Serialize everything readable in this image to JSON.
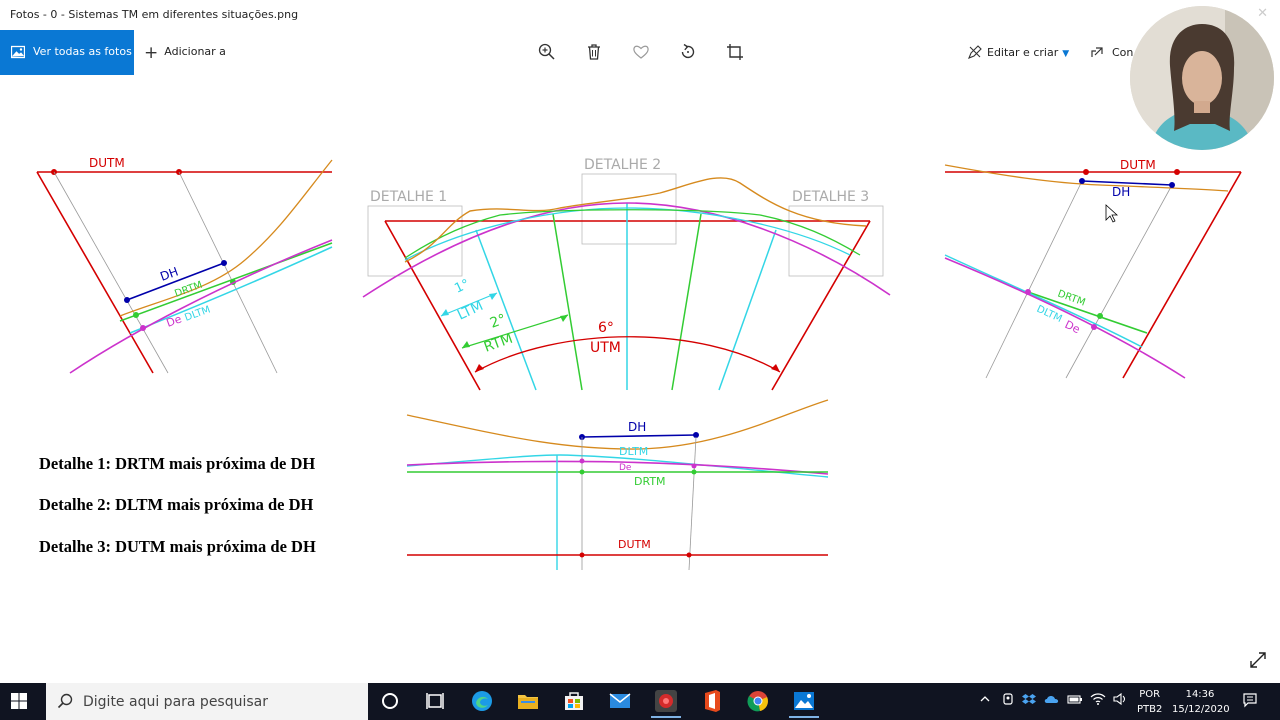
{
  "window": {
    "title": "Fotos - 0 - Sistemas TM em diferentes situações.png",
    "close_glyph": "✕"
  },
  "toolbar": {
    "view_all_label": "Ver todas as fotos",
    "add_label": "Adicionar a",
    "edit_label": "Editar e criar",
    "share_label": "Con",
    "icons": [
      "zoom-in-icon",
      "delete-icon",
      "favorite-icon",
      "rotate-icon",
      "crop-icon"
    ]
  },
  "diagram": {
    "left": {
      "durtm": "DUTM",
      "dh": "DH",
      "drtm": "DRTM",
      "de": "De",
      "dltm": "DLTM"
    },
    "center": {
      "detail1": "DETALHE 1",
      "detail2": "DETALHE 2",
      "detail3": "DETALHE 3",
      "angle_ltm": "1°",
      "ltm": "LTM",
      "angle_rtm": "2°",
      "rtm": "RTM",
      "angle_utm": "6°",
      "utm": "UTM"
    },
    "right": {
      "durtm": "DUTM",
      "dh": "DH",
      "drtm": "DRTM",
      "dltm": "DLTM",
      "de": "De"
    },
    "bottom": {
      "dh": "DH",
      "dltm": "DLTM",
      "de": "De",
      "drtm": "DRTM",
      "durtm": "DUTM"
    },
    "colors": {
      "red": "#d40000",
      "orange": "#d68a1e",
      "green": "#33cc33",
      "cyan": "#33d6e6",
      "magenta": "#cc33cc",
      "blue": "#0000aa",
      "gray": "#999999"
    }
  },
  "captions": [
    "Detalhe 1: DRTM mais próxima de DH",
    "Detalhe 2: DLTM mais próxima de DH",
    "Detalhe 3: DUTM mais próxima de DH"
  ],
  "taskbar": {
    "search_placeholder": "Digite aqui para pesquisar",
    "language_top": "POR",
    "language_bottom": "PTB2",
    "time": "14:36",
    "date": "15/12/2020"
  }
}
